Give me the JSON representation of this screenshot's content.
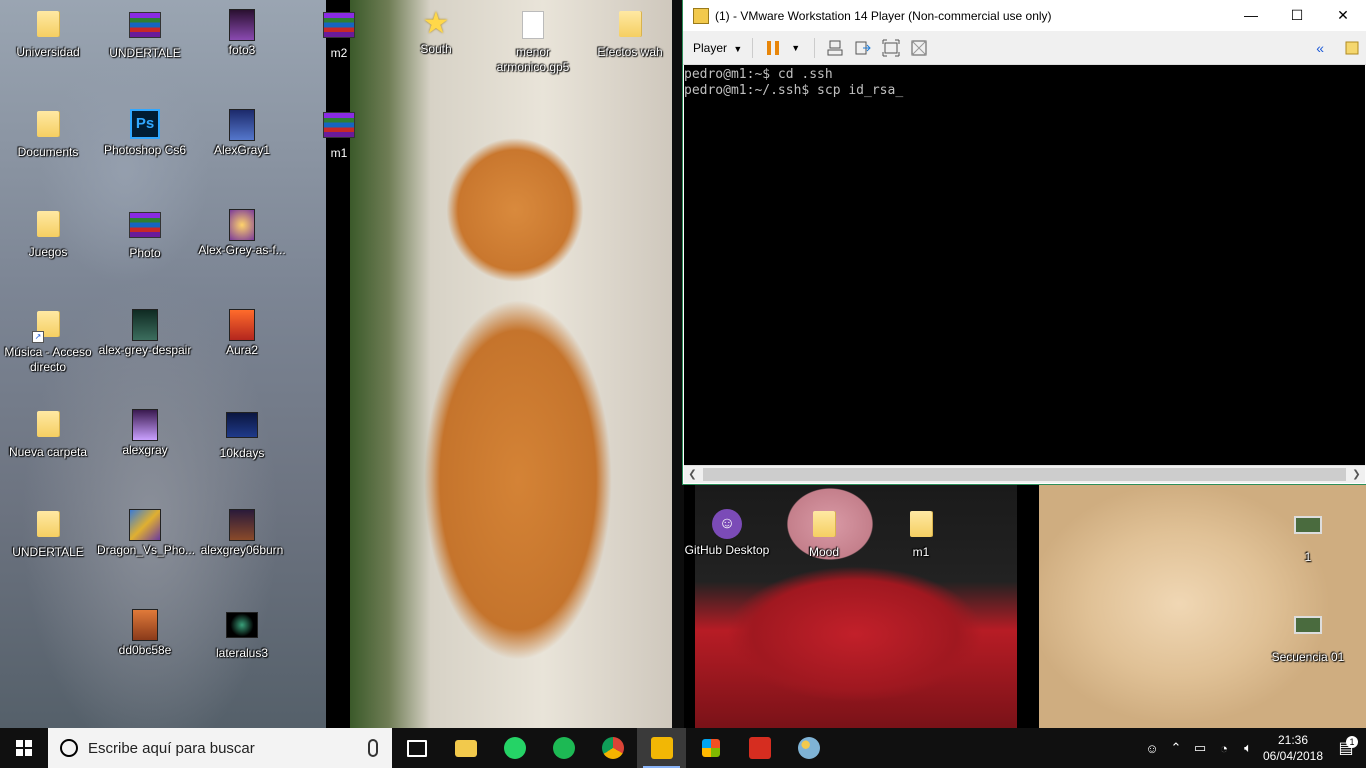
{
  "desktop": {
    "icons": [
      {
        "label": "Universidad",
        "icon": "folder-icon"
      },
      {
        "label": "UNDERTALE",
        "icon": "winrar-archive-icon"
      },
      {
        "label": "foto3",
        "icon": "image-file-icon"
      },
      {
        "label": "m2",
        "icon": "winrar-archive-icon"
      },
      {
        "label": "South",
        "icon": "star-icon"
      },
      {
        "label": "menor armonico.gp5",
        "icon": "document-file-icon"
      },
      {
        "label": "Efectos wah",
        "icon": "folder-icon"
      },
      {
        "label": "Documents",
        "icon": "folder-icon"
      },
      {
        "label": "Photoshop Cs6",
        "icon": "photoshop-icon"
      },
      {
        "label": "AlexGray1",
        "icon": "image-file-icon"
      },
      {
        "label": "m1",
        "icon": "winrar-archive-icon"
      },
      {
        "label": "Juegos",
        "icon": "folder-icon"
      },
      {
        "label": "Photo",
        "icon": "winrar-archive-icon"
      },
      {
        "label": "Alex-Grey-as-f...",
        "icon": "image-file-icon"
      },
      {
        "label": "Música - Acceso directo",
        "icon": "music-shortcut-icon"
      },
      {
        "label": "alex-grey-despair",
        "icon": "image-file-icon"
      },
      {
        "label": "Aura2",
        "icon": "image-file-icon"
      },
      {
        "label": "Nueva carpeta",
        "icon": "folder-icon"
      },
      {
        "label": "alexgray",
        "icon": "image-file-icon"
      },
      {
        "label": "10kdays",
        "icon": "image-file-icon"
      },
      {
        "label": "UNDERTALE",
        "icon": "folder-icon"
      },
      {
        "label": "Dragon_Vs_Pho...",
        "icon": "image-file-icon"
      },
      {
        "label": "alexgrey06burn",
        "icon": "image-file-icon"
      },
      {
        "label": "dd0bc58e",
        "icon": "image-file-icon"
      },
      {
        "label": "lateralus3",
        "icon": "image-file-icon"
      },
      {
        "label": "GitHub Desktop",
        "icon": "github-desktop-icon"
      },
      {
        "label": "Mood",
        "icon": "folder-icon"
      },
      {
        "label": "m1",
        "icon": "folder-icon"
      },
      {
        "label": "1",
        "icon": "video-file-icon"
      },
      {
        "label": "Secuencia 01",
        "icon": "video-file-icon"
      }
    ]
  },
  "vmware": {
    "title": "(1) - VMware Workstation 14 Player (Non-commercial use only)",
    "menu_label": "Player",
    "console_lines": [
      "pedro@m1:~$ cd .ssh",
      "pedro@m1:~/.ssh$ scp id_rsa_"
    ],
    "minimize_glyph": "—",
    "maximize_glyph": "☐",
    "close_glyph": "✕"
  },
  "taskbar": {
    "search_placeholder": "Escribe aquí para buscar",
    "apps": [
      {
        "name": "task-view-icon",
        "color": "#ffffff"
      },
      {
        "name": "file-explorer-icon",
        "color": "#f2c94c"
      },
      {
        "name": "whatsapp-icon",
        "color": "#25d366"
      },
      {
        "name": "spotify-icon",
        "color": "#1db954"
      },
      {
        "name": "chrome-icon",
        "color": "#db4437"
      },
      {
        "name": "vmware-icon",
        "color": "#f2b705"
      },
      {
        "name": "microsoft-store-icon",
        "color": "#0078d7"
      },
      {
        "name": "pdf-reader-icon",
        "color": "#d62d20"
      },
      {
        "name": "paint-icon",
        "color": "#7fb3d5"
      }
    ],
    "time": "21:36",
    "date": "06/04/2018",
    "notification_count": "1"
  }
}
